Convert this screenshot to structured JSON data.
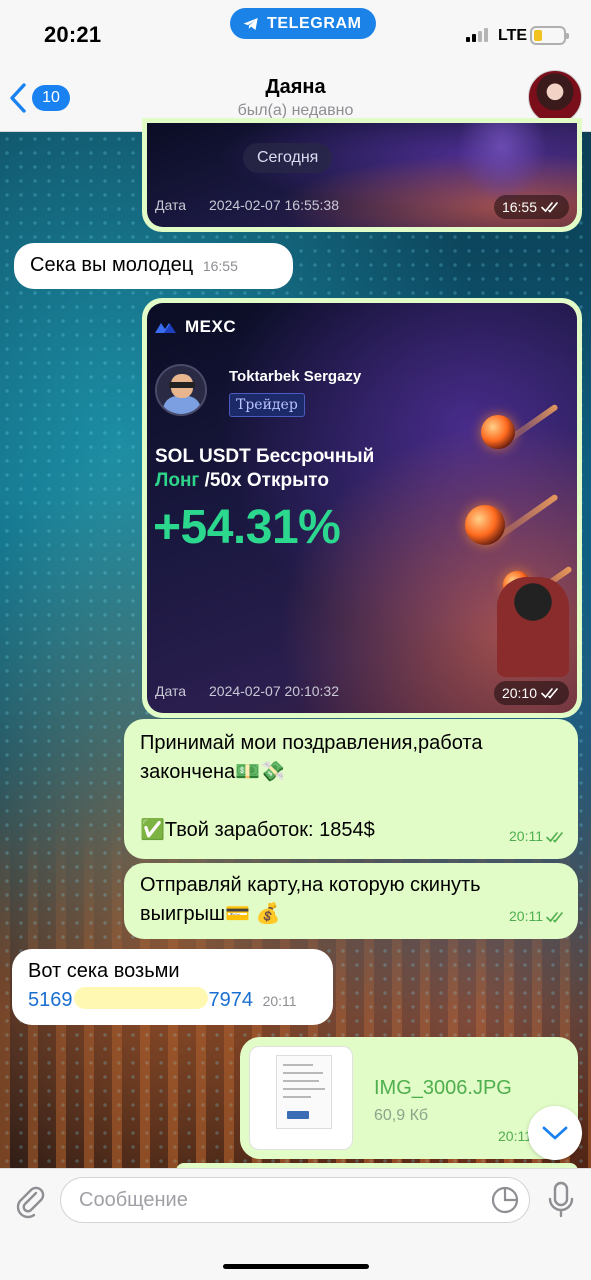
{
  "status_bar": {
    "time": "20:21",
    "carrier_pill": "TELEGRAM",
    "network": "LTE",
    "battery_fraction": 0.3
  },
  "header": {
    "back_count": "10",
    "contact_name": "Даяна",
    "contact_status": "был(а) недавно"
  },
  "messages": [
    {
      "type": "photo-card",
      "direction": "out",
      "date_pill": "Сегодня",
      "date_label": "Дата",
      "date_value": "2024-02-07 16:55:38",
      "time": "16:55"
    },
    {
      "type": "text",
      "direction": "in",
      "text": "Сека вы молодец",
      "time": "16:55"
    },
    {
      "type": "trade-card",
      "direction": "out",
      "brand": "MEXC",
      "trader_name": "Toktarbek Sergazy",
      "trader_role": "Трейдер",
      "pair_line1": "SOL USDT Бессрочный",
      "pair_side": "Лонг",
      "pair_line2_rest": " /50x Открыто",
      "pnl": "+54.31%",
      "date_label": "Дата",
      "date_value": "2024-02-07 20:10:32",
      "time": "20:10"
    },
    {
      "type": "text",
      "direction": "out",
      "line1": "Принимай мои поздравления,работа",
      "line2": "закончена💵💸",
      "line3": "✅Твой заработок: 1854$",
      "time": "20:11"
    },
    {
      "type": "text",
      "direction": "out",
      "line1": "Отправляй карту,на которую скинуть",
      "line2": "выигрыш💳 💰",
      "time": "20:11"
    },
    {
      "type": "text",
      "direction": "in",
      "line1": "Вот сека возьми",
      "card_start": "5169",
      "card_end": "7974",
      "time": "20:11"
    },
    {
      "type": "file",
      "direction": "out",
      "file_name": "IMG_3006.JPG",
      "file_size": "60,9 Кб",
      "time": "20:11"
    }
  ],
  "input": {
    "placeholder": "Сообщение"
  },
  "icons": {
    "back": "chevron-left-icon",
    "attach": "paperclip-icon",
    "sticker": "sticker-icon",
    "mic": "microphone-icon",
    "scroll": "chevron-down-icon"
  },
  "colors": {
    "accent": "#1a82f0",
    "outgoing_bubble": "#e2fcc8",
    "incoming_bubble": "#ffffff",
    "check_green": "#4fae4e",
    "pnl_green": "#2cd88d"
  }
}
